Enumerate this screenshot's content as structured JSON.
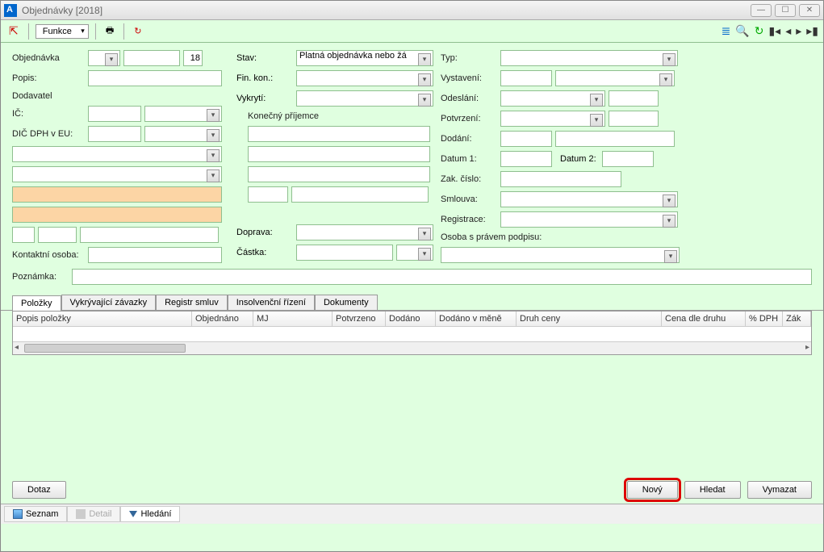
{
  "window": {
    "title": "Objednávky [2018]"
  },
  "toolbar": {
    "funkce": "Funkce"
  },
  "form": {
    "objednavka_label": "Objednávka",
    "objednavka_year": "18",
    "popis_label": "Popis:",
    "dodavatel_label": "Dodavatel",
    "ic_label": "IČ:",
    "dic_label": "DIČ DPH v EU:",
    "kontakt_label": "Kontaktní osoba:",
    "stav_label": "Stav:",
    "stav_value": "Platná objednávka nebo žá",
    "finkon_label": "Fin. kon.:",
    "vykryti_label": "Vykrytí:",
    "konecny_label": "Konečný příjemce",
    "doprava_label": "Doprava:",
    "castka_label": "Částka:",
    "typ_label": "Typ:",
    "vystaveni_label": "Vystavení:",
    "odeslani_label": "Odeslání:",
    "potvrzeni_label": "Potvrzení:",
    "dodani_label": "Dodání:",
    "datum1_label": "Datum 1:",
    "datum2_label": "Datum 2:",
    "zakcislo_label": "Zak. číslo:",
    "smlouva_label": "Smlouva:",
    "registrace_label": "Registrace:",
    "osoba_podpis_label": "Osoba s právem podpisu:",
    "poznamka_label": "Poznámka:"
  },
  "tabs": {
    "polozky": "Položky",
    "vykryvajici": "Vykrývající závazky",
    "registr": "Registr smluv",
    "insolvencni": "Insolvenční řízení",
    "dokumenty": "Dokumenty"
  },
  "grid_columns": {
    "popis": "Popis položky",
    "objednano": "Objednáno",
    "mj": "MJ",
    "potvrzeno": "Potvrzeno",
    "dodano": "Dodáno",
    "dodano_mene": "Dodáno v měně",
    "druh_ceny": "Druh ceny",
    "cena_druh": "Cena dle druhu",
    "pdph": "% DPH",
    "zak": "Zák"
  },
  "buttons": {
    "dotaz": "Dotaz",
    "novy": "Nový",
    "hledat": "Hledat",
    "vymazat": "Vymazat"
  },
  "bottom_tabs": {
    "seznam": "Seznam",
    "detail": "Detail",
    "hledani": "Hledání"
  }
}
